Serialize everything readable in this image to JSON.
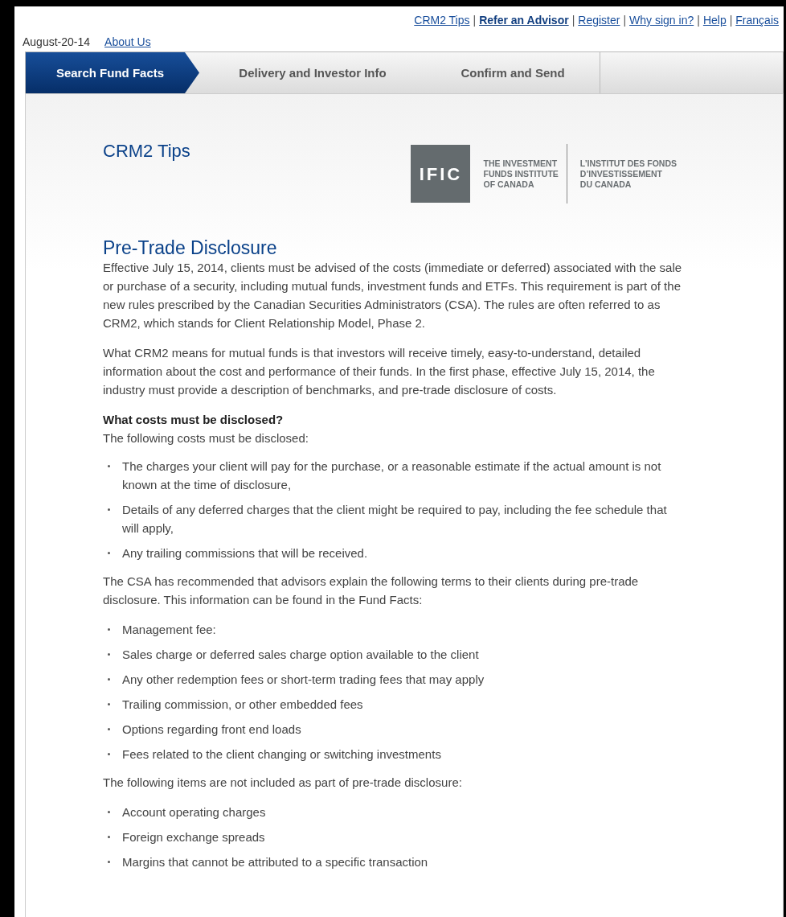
{
  "top_links": [
    {
      "label": "CRM2 Tips",
      "bold": false
    },
    {
      "label": "Refer an Advisor",
      "bold": true
    },
    {
      "label": "Register",
      "bold": false
    },
    {
      "label": "Why sign in?",
      "bold": false
    },
    {
      "label": "Help",
      "bold": false
    },
    {
      "label": "Français",
      "bold": false
    }
  ],
  "separator": "|",
  "date": "August-20-14",
  "about_link": "About Us",
  "tabs": [
    {
      "label": "Search Fund Facts",
      "selected": true
    },
    {
      "label": "Delivery and Investor Info",
      "selected": false
    },
    {
      "label": "Confirm and Send",
      "selected": false
    }
  ],
  "page_title": "CRM2 Tips",
  "logo": {
    "mark": "IFIC",
    "english": [
      "THE INVESTMENT",
      "FUNDS INSTITUTE",
      "OF CANADA"
    ],
    "french": [
      "L’INSTITUT DES FONDS",
      "D’INVESTISSEMENT",
      "DU CANADA"
    ]
  },
  "article": {
    "heading": "Pre-Trade Disclosure",
    "blocks": [
      {
        "kind": "paragraph",
        "text": "Effective July 15, 2014, clients must be advised of the costs (immediate or deferred) associated with the sale or purchase of a security, including mutual funds, investment funds and ETFs. This requirement is part of the new rules prescribed by the Canadian Securities Administrators (CSA). The rules are often referred to as CRM2, which stands for Client Relationship Model, Phase 2."
      },
      {
        "kind": "paragraph",
        "text": "What CRM2 means for mutual funds is that investors will receive timely, easy-to-understand, detailed information about the cost and performance of their funds. In the first phase, effective July 15, 2014, the industry must provide a description of benchmarks, and pre-trade disclosure of costs."
      },
      {
        "kind": "subheading",
        "text": "What costs must be disclosed?"
      },
      {
        "kind": "intro",
        "text": "The following costs must be disclosed:"
      },
      {
        "kind": "list",
        "items": [
          "The charges your client will pay for the purchase, or a reasonable estimate if the actual amount is not known at the time of disclosure,",
          "Details of any deferred charges that the client might be required to pay, including the fee schedule that will apply,",
          "Any trailing commissions that will be received."
        ]
      },
      {
        "kind": "paragraph",
        "text": "The CSA has recommended that advisors explain the following terms to their clients during pre-trade disclosure. This information can be found in the Fund Facts:"
      },
      {
        "kind": "list",
        "items": [
          "Management fee:",
          "Sales charge or deferred sales charge option available to the client",
          "Any other redemption fees or short-term trading fees that may apply",
          "Trailing commission, or other embedded fees",
          "Options regarding front end loads",
          "Fees related to the client changing or switching investments"
        ]
      },
      {
        "kind": "paragraph",
        "text": "The following items are not included as part of pre-trade disclosure:"
      },
      {
        "kind": "list",
        "items": [
          "Account operating charges",
          "Foreign exchange spreads",
          "Margins that cannot be attributed to a specific transaction"
        ]
      }
    ]
  }
}
